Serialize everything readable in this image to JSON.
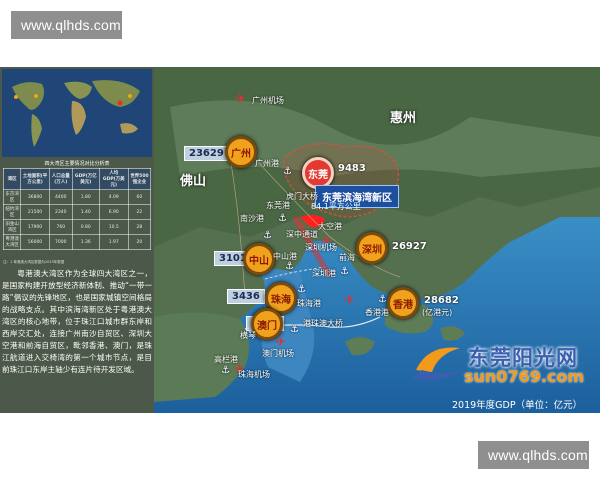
{
  "watermarks": {
    "top": "www.qlhds.com",
    "bottom": "www.qlhds.com"
  },
  "map": {
    "regions": [
      "惠州",
      "佛山"
    ],
    "cities": {
      "guangzhou": "广州",
      "dongguan": "东莞",
      "shenzhen": "深圳",
      "zhongshan": "中山",
      "zhuhai": "珠海",
      "aomen": "澳门",
      "xianggang": "香港"
    },
    "gdp": {
      "guangzhou": "23629",
      "dongguan": "9483",
      "shenzhen": "26927",
      "zhongshan": "3101",
      "zhuhai": "3436",
      "aomen": "4347",
      "xianggang": "28682",
      "xianggang_unit": "(亿港元)"
    },
    "place_labels": {
      "guangzhou_airport": "广州机场",
      "guangzhou_port": "广州港",
      "nansha_port": "南沙港",
      "zhongshan_port": "中山港",
      "shenzhen_airport": "深圳机场",
      "shenzhen_port": "深圳港",
      "dongguan_port": "东莞港",
      "qianhai": "前海",
      "humen_bridge": "虎门大桥",
      "shenzhong": "深中通道",
      "dakong": "大空港",
      "xianggang_port": "香港港",
      "xianggang_airport": "香港机场",
      "aomen_airport": "澳门机场",
      "zhuhai_airport": "珠海机场",
      "gaolan_port": "高栏港",
      "hengqin": "横琴",
      "zhuhai_port": "珠海港",
      "hzm_bridge": "港珠澳大桥",
      "guangshen": "广深港",
      "aomen_port": "澳门港"
    },
    "callout": "东莞滨海湾新区",
    "area": "84.1平方公里",
    "brand": {
      "cn": "东莞阳光网",
      "url": "sun0769.com"
    },
    "caption": "2019年度GDP（单位：亿元）",
    "colors": {
      "badge": "#f0a21d",
      "highlight": "#e23a30",
      "callout": "#1d4f9f",
      "gdp_label": "#1a2a55"
    }
  },
  "left_panel": {
    "table_title": "四大湾区主要情况对比分析表",
    "table_headers": [
      "湾区",
      "土地面积(平方公里)",
      "人口总量(万人)",
      "GDP(万亿美元)",
      "人均GDP(万美元)",
      "世界500强企业"
    ],
    "table_rows": [
      [
        "东京湾区",
        "36800",
        "4400",
        "1.80",
        "4.09",
        "60"
      ],
      [
        "纽约湾区",
        "21500",
        "2340",
        "1.40",
        "6.90",
        "22"
      ],
      [
        "旧金山湾区",
        "17900",
        "760",
        "0.80",
        "10.5",
        "28"
      ],
      [
        "粤港澳大湾区",
        "56000",
        "7000",
        "1.36",
        "1.97",
        "20"
      ]
    ],
    "table_note": "注：1 粤港澳大湾区数据为2019年数据",
    "description": "粤港澳大湾区作为全球四大湾区之一，是国家构建开放型经济新体制、推动“一带一路”倡议的先锋地区，也是国家城镇空间格局的战略支点。其中滨海湾新区处于粤港澳大湾区的核心地带，位于珠江口城市群东岸和西岸交汇处，连接广州南沙自贸区、深圳大空港和前海自贸区，毗邻香港、澳门，是珠江航道进入交椅湾的第一个城市节点，是目前珠江口东岸主轴少有连片待开发区域。"
  }
}
